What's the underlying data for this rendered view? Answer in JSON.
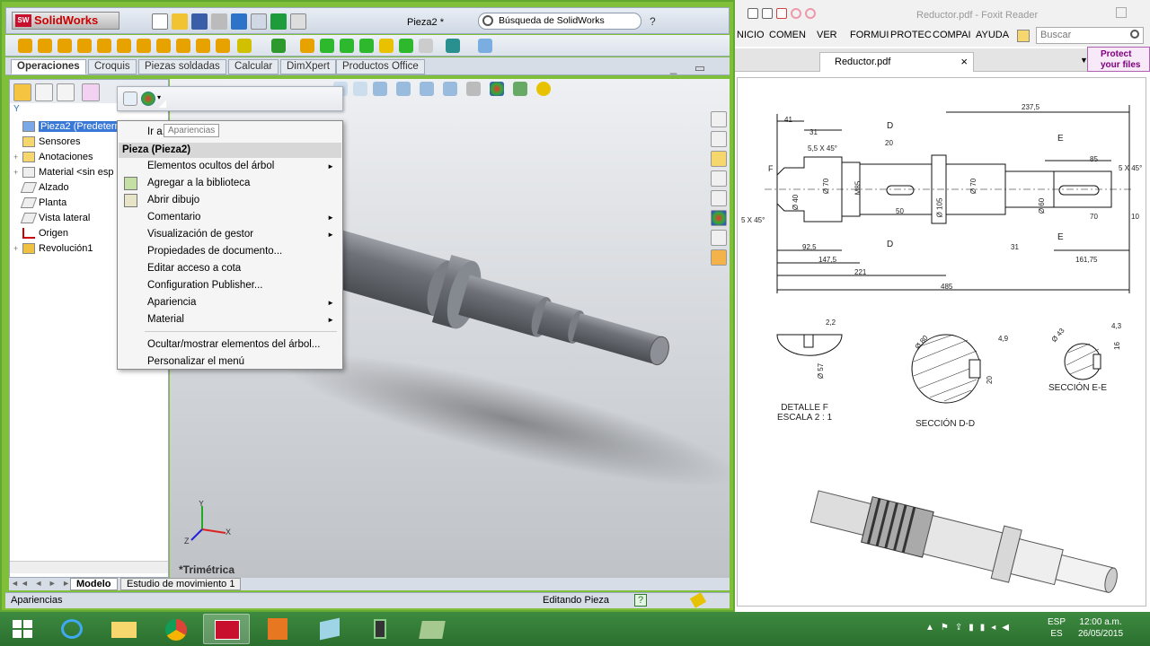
{
  "solidworks": {
    "app_name": "SolidWorks",
    "doc_title": "Pieza2 *",
    "search_placeholder": "Búsqueda de SolidWorks",
    "help": "?",
    "cm_tabs": [
      "Operaciones",
      "Croquis",
      "Piezas soldadas",
      "Calcular",
      "DimXpert",
      "Productos Office"
    ],
    "filter": "Y",
    "tree": [
      {
        "label": "Pieza2  (Predetermin",
        "expand": ""
      },
      {
        "label": "Sensores",
        "expand": ""
      },
      {
        "label": "Anotaciones",
        "expand": "+"
      },
      {
        "label": "Material <sin esp",
        "expand": "+"
      },
      {
        "label": "Alzado",
        "expand": ""
      },
      {
        "label": "Planta",
        "expand": ""
      },
      {
        "label": "Vista lateral",
        "expand": ""
      },
      {
        "label": "Origen",
        "expand": ""
      },
      {
        "label": "Revolución1",
        "expand": "+"
      }
    ],
    "view_label": "*Trimétrica",
    "bottom_tabs": [
      "Modelo",
      "Estudio de movimiento 1"
    ],
    "status_left": "Apariencias",
    "status_mode": "Editando Pieza",
    "status_help": "?",
    "tooltip": "Apariencias",
    "axis_y": "Y",
    "axis_x": "X",
    "axis_z": "Z"
  },
  "context_menu": {
    "goto_label": "Ir a...",
    "header": "Pieza (Pieza2)",
    "items": [
      {
        "label": "Elementos ocultos del árbol",
        "submenu": "►"
      },
      {
        "label": "Agregar a la biblioteca",
        "submenu": ""
      },
      {
        "label": "Abrir dibujo",
        "submenu": ""
      },
      {
        "label": "Comentario",
        "submenu": "►"
      },
      {
        "label": "Visualización de gestor",
        "submenu": "►"
      },
      {
        "label": "Propiedades de documento...",
        "submenu": ""
      },
      {
        "label": "Editar acceso a cota",
        "submenu": ""
      },
      {
        "label": "Configuration Publisher...",
        "submenu": ""
      },
      {
        "label": "Apariencia",
        "submenu": "►"
      },
      {
        "label": "Material",
        "submenu": "►"
      },
      {
        "label": "Ocultar/mostrar elementos del árbol...",
        "submenu": ""
      },
      {
        "label": "Personalizar el menú",
        "submenu": ""
      }
    ]
  },
  "foxit": {
    "title": "Reductor.pdf - Foxit Reader",
    "menu": [
      "NICIO",
      "COMEN",
      "VER",
      "FORMUI",
      "PROTEC",
      "COMPAI",
      "AYUDA"
    ],
    "search_placeholder": "Buscar",
    "tab": "Reductor.pdf",
    "tab_close": "×",
    "protect": "Protect your files",
    "drawing": {
      "dims_top": [
        "41",
        "31",
        "5,5 X 45°",
        "20",
        "D",
        "237,5",
        "E",
        "85",
        "5 X 45°"
      ],
      "dims_side": [
        "F",
        "5 X 45°",
        "Ø 40",
        "Ø 70",
        "M85",
        "50",
        "Ø 105",
        "Ø 70",
        "Ø 60",
        "70",
        "10"
      ],
      "dims_bottom": [
        "92,5",
        "31",
        "D",
        "E",
        "147,5",
        "161,75",
        "221",
        "485"
      ],
      "detail_f": [
        "2,2",
        "Ø 57"
      ],
      "section_dd": [
        "Ø 80",
        "4,9",
        "20"
      ],
      "section_ee": [
        "Ø 43",
        "4,3",
        "16"
      ],
      "cap_detail": "DETALLE F\nESCALA 2 : 1",
      "cap_dd": "SECCIÓN D-D",
      "cap_ee": "SECCIÓN E-E"
    }
  },
  "taskbar": {
    "lang_top": "ESP",
    "lang_bottom": "ES",
    "time": "12:00 a.m.",
    "date": "26/05/2015"
  }
}
